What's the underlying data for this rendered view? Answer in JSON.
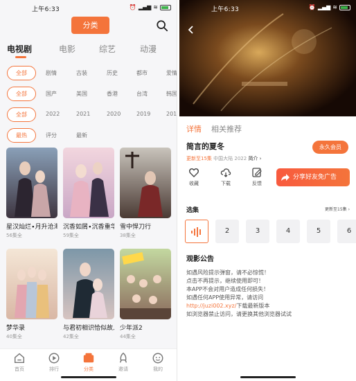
{
  "left": {
    "status": {
      "time": "上午6:33",
      "battery": "29"
    },
    "header": {
      "title": "分类"
    },
    "type_tabs": [
      "电视剧",
      "电影",
      "综艺",
      "动漫"
    ],
    "filters": [
      {
        "chip": "全部",
        "options": [
          "剧情",
          "古装",
          "历史",
          "都市",
          "爱情"
        ]
      },
      {
        "chip": "全部",
        "options": [
          "国产",
          "美国",
          "香港",
          "台湾",
          "韩国"
        ]
      },
      {
        "chip": "全部",
        "options": [
          "2022",
          "2021",
          "2020",
          "2019",
          "2018"
        ]
      },
      {
        "chip": "最热",
        "options": [
          "评分",
          "最新"
        ]
      }
    ],
    "cards": [
      {
        "title": "星汉灿烂∙月升沧海",
        "sub": "56集全"
      },
      {
        "title": "沉香如屑∙沉香重华",
        "sub": "59集全"
      },
      {
        "title": "雪中悍刀行",
        "sub": "38集全"
      },
      {
        "title": "梦华录",
        "sub": "40集全"
      },
      {
        "title": "与君初相识恰似故人归",
        "sub": "42集全"
      },
      {
        "title": "少年派2",
        "sub": "44集全"
      }
    ],
    "nav": [
      {
        "label": "首页",
        "icon": "home-icon"
      },
      {
        "label": "排行",
        "icon": "rank-icon"
      },
      {
        "label": "分类",
        "icon": "category-icon"
      },
      {
        "label": "邀请",
        "icon": "rocket-icon"
      },
      {
        "label": "我的",
        "icon": "profile-icon"
      }
    ]
  },
  "right": {
    "status": {
      "time": "上午6:33",
      "battery": "29"
    },
    "tabs": {
      "details": "详情",
      "related": "相关推荐"
    },
    "show": {
      "title": "简言的夏冬",
      "updated": "更新至15集",
      "meta": "中国大陆  2022",
      "intro": "简介 ›",
      "vip": "永久会员"
    },
    "actions": {
      "favorite": "收藏",
      "download": "下载",
      "feedback": "反馈",
      "share": "分享好友免广告"
    },
    "episodes": {
      "title": "选集",
      "more": "更新至15集 ›",
      "items": [
        "2",
        "3",
        "4",
        "5",
        "6"
      ]
    },
    "notice": {
      "title": "观影公告",
      "lines": [
        "如遇风险提示弹窗，请不必惊慌！",
        "点击不再提示，继续使用即可！",
        "本APP不会对用户造成任何损失！",
        "如遇任何APP使用异常，请访问"
      ],
      "link": "http://juzi002.xyz/",
      "link_suffix": "下载最新版本",
      "last": "如浏览器禁止访问，请更换其他浏览器试试"
    }
  },
  "colors": {
    "accent": "#f4743b"
  }
}
